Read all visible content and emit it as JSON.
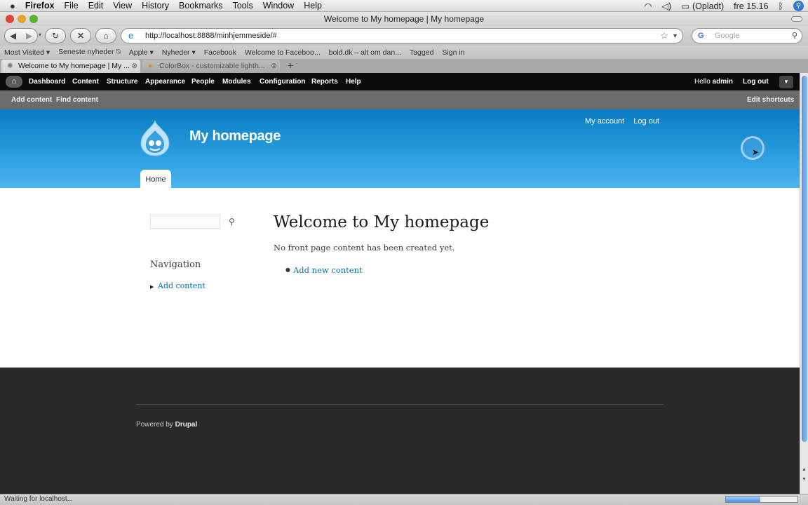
{
  "mac_menu": {
    "app": "Firefox",
    "items": [
      "File",
      "Edit",
      "View",
      "History",
      "Bookmarks",
      "Tools",
      "Window",
      "Help"
    ],
    "battery": "(Opladt)",
    "clock": "fre 15.16"
  },
  "window": {
    "title": "Welcome to My homepage | My homepage"
  },
  "nav": {
    "url": "http://localhost:8888/minhjemmeside/#",
    "search_placeholder": "Google"
  },
  "bookmarks": [
    "Most Visited ▾",
    "Seneste nyheder ⍉",
    "Apple ▾",
    "Nyheder ▾",
    "Facebook",
    "Welcome to Faceboo...",
    "bold.dk – alt om dan...",
    "Tagged",
    "Sign in"
  ],
  "tabs": [
    {
      "label": "Welcome to My homepage | My ..."
    },
    {
      "label": "ColorBox - customizable lighth..."
    }
  ],
  "drupal_toolbar": {
    "items": [
      "Dashboard",
      "Content",
      "Structure",
      "Appearance",
      "People",
      "Modules",
      "Configuration",
      "Reports",
      "Help"
    ],
    "hello_prefix": "Hello ",
    "user": "admin",
    "logout": "Log out"
  },
  "shortcuts": {
    "items": [
      "Add content",
      "Find content"
    ],
    "edit": "Edit shortcuts"
  },
  "header": {
    "site_name": "My homepage",
    "links": [
      "My account",
      "Log out"
    ],
    "home_tab": "Home"
  },
  "sidebar": {
    "nav_title": "Navigation",
    "nav_items": [
      "Add content"
    ]
  },
  "main": {
    "title": "Welcome to My homepage",
    "message": "No front page content has been created yet.",
    "links": [
      "Add new content"
    ]
  },
  "footer": {
    "powered_prefix": "Powered by ",
    "powered_link": "Drupal"
  },
  "status": {
    "text": "Waiting for localhost..."
  },
  "colors": {
    "header_top": "#0a7bc1",
    "header_bottom": "#4bb4ee",
    "toolbar": "#0c0c0c",
    "footer": "#292929",
    "link": "#0071b3"
  }
}
